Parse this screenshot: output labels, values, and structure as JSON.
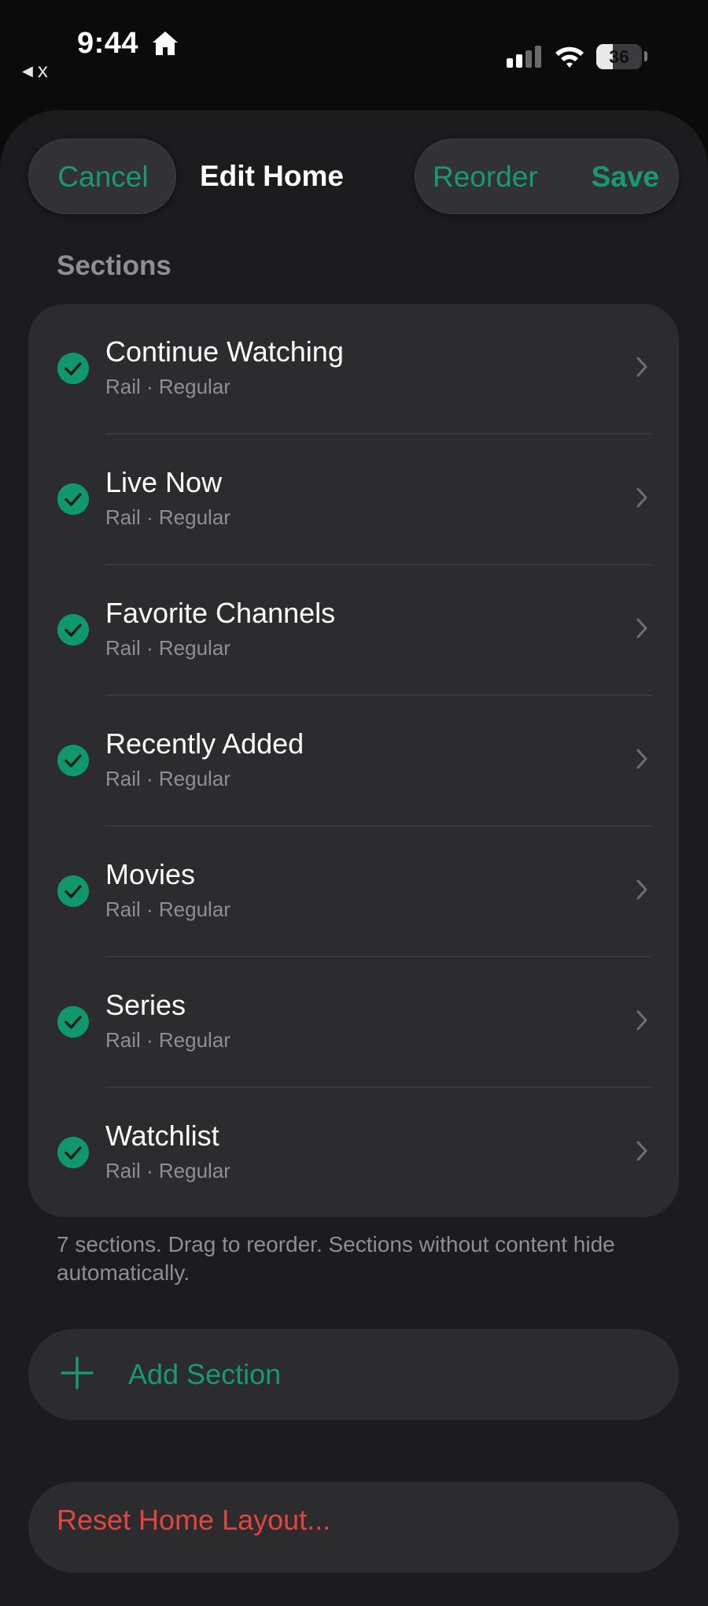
{
  "status_bar": {
    "time": "9:44",
    "back_app": "x",
    "battery_level": "36",
    "battery_fraction": 0.36,
    "icons": [
      "home-icon",
      "back-triangle-icon",
      "cellular-signal-icon",
      "wifi-icon",
      "battery-icon"
    ]
  },
  "nav": {
    "cancel_label": "Cancel",
    "title": "Edit Home",
    "reorder_label": "Reorder",
    "save_label": "Save"
  },
  "sections": {
    "header": "Sections",
    "items": [
      {
        "title": "Continue Watching",
        "subtitle": "Rail · Regular",
        "enabled": true
      },
      {
        "title": "Live Now",
        "subtitle": "Rail · Regular",
        "enabled": true
      },
      {
        "title": "Favorite Channels",
        "subtitle": "Rail · Regular",
        "enabled": true
      },
      {
        "title": "Recently Added",
        "subtitle": "Rail · Regular",
        "enabled": true
      },
      {
        "title": "Movies",
        "subtitle": "Rail · Regular",
        "enabled": true
      },
      {
        "title": "Series",
        "subtitle": "Rail · Regular",
        "enabled": true
      },
      {
        "title": "Watchlist",
        "subtitle": "Rail · Regular",
        "enabled": true
      }
    ],
    "footer": "7 sections. Drag to reorder. Sections without content hide automatically."
  },
  "actions": {
    "add_label": "Add Section",
    "reset_label": "Reset Home Layout..."
  },
  "colors": {
    "accent": "#189a6e",
    "check": "#10986c",
    "destructive": "#e0463f",
    "background": "#1c1c1e",
    "card": "#2c2c2e",
    "secondary_text": "#8e8e93"
  }
}
